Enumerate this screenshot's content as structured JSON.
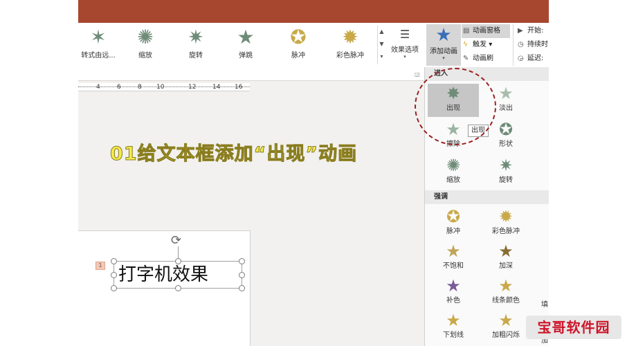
{
  "colors": {
    "titlebar": "#a7472f",
    "ring": "#9a2121",
    "overlay_text": "#f4ea4a",
    "watermark": "#d0142a",
    "star_green": "#6f8c78",
    "star_gold": "#c9a94a",
    "add_star_blue": "#3a6fb8"
  },
  "ribbon": {
    "gallery": [
      {
        "label": "转式由远...",
        "icon": "star-zoom-icon"
      },
      {
        "label": "缩放",
        "icon": "star-burst-icon"
      },
      {
        "label": "旋转",
        "icon": "star-spin-icon"
      },
      {
        "label": "弹跳",
        "icon": "star-bounce-icon"
      },
      {
        "label": "脉冲",
        "icon": "star-pulse-icon"
      },
      {
        "label": "彩色脉冲",
        "icon": "star-color-pulse-icon"
      }
    ],
    "effect_options": {
      "label": "效果选项"
    },
    "add_animation": {
      "label": "添加动画"
    },
    "anim_tools": [
      {
        "label": "动画窗格",
        "icon": "pane-icon"
      },
      {
        "label": "触发",
        "icon": "trigger-icon",
        "dropdown": "▾"
      },
      {
        "label": "动画刷",
        "icon": "brush-icon"
      }
    ],
    "timing": [
      {
        "label": "开始:",
        "icon": "play-icon"
      },
      {
        "label": "持续时",
        "icon": "clock-icon"
      },
      {
        "label": "延迟:",
        "icon": "delay-icon"
      }
    ]
  },
  "ruler": {
    "ticks": [
      "4",
      "6",
      "8",
      "10",
      "12",
      "14",
      "16"
    ]
  },
  "overlay_title": "01给文本框添加“出现”动画",
  "slide": {
    "badge": "1",
    "textbox_text": "打字机效果"
  },
  "panel": {
    "entrance_header": "进入",
    "entrance_items": [
      {
        "label": "出现",
        "icon": "star-appear-icon",
        "selected": true
      },
      {
        "label": "淡出",
        "icon": "star-fade-icon"
      },
      {
        "label": "擦除",
        "icon": "star-wipe-icon"
      },
      {
        "label": "形状",
        "icon": "star-shape-icon"
      },
      {
        "label": "缩放",
        "icon": "star-zoom-in-icon"
      },
      {
        "label": "旋转",
        "icon": "star-rotate-icon"
      }
    ],
    "emphasis_header": "强调",
    "emphasis_items": [
      {
        "label": "脉冲",
        "icon": "star-pulse-icon"
      },
      {
        "label": "彩色脉冲",
        "icon": "star-color-pulse-icon"
      },
      {
        "label": "不饱和",
        "icon": "star-desaturate-icon"
      },
      {
        "label": "加深",
        "icon": "star-darken-icon"
      },
      {
        "label": "补色",
        "icon": "star-complement-icon"
      },
      {
        "label": "线条颜色",
        "icon": "star-line-color-icon"
      },
      {
        "label": "下划线",
        "icon": "star-underline-icon"
      },
      {
        "label": "加粗闪烁",
        "icon": "star-bold-flash-icon"
      }
    ],
    "edge_labels": [
      "填",
      "加"
    ],
    "tooltip": "出现"
  },
  "watermark": "宝哥软件园"
}
